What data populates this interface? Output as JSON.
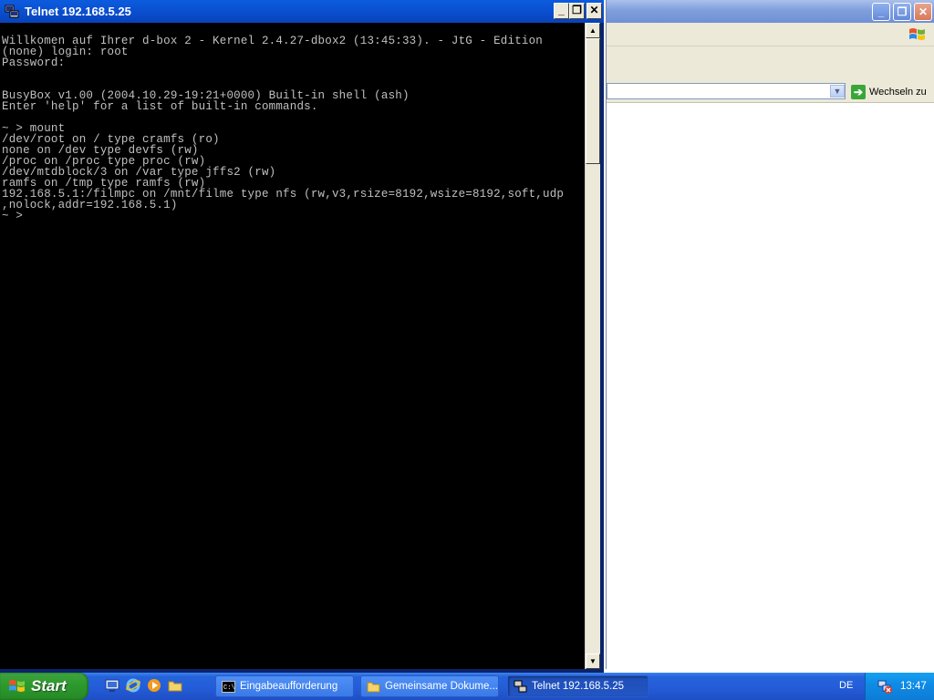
{
  "telnet_window": {
    "title": "Telnet 192.168.5.25",
    "console_lines": [
      "Willkomen auf Ihrer d-box 2 - Kernel 2.4.27-dbox2 (13:45:33). - JtG - Edition",
      "(none) login: root",
      "Password:",
      "",
      "",
      "BusyBox v1.00 (2004.10.29-19:21+0000) Built-in shell (ash)",
      "Enter 'help' for a list of built-in commands.",
      "",
      "~ > mount",
      "/dev/root on / type cramfs (ro)",
      "none on /dev type devfs (rw)",
      "/proc on /proc type proc (rw)",
      "/dev/mtdblock/3 on /var type jffs2 (rw)",
      "ramfs on /tmp type ramfs (rw)",
      "192.168.5.1:/filmpc on /mnt/filme type nfs (rw,v3,rsize=8192,wsize=8192,soft,udp",
      ",nolock,addr=192.168.5.1)",
      "~ > "
    ]
  },
  "background_window": {
    "go_button_label": "Wechseln zu"
  },
  "taskbar": {
    "start_label": "Start",
    "tasks": [
      {
        "label": "Eingabeaufforderung"
      },
      {
        "label": "Gemeinsame Dokume..."
      },
      {
        "label": "Telnet 192.168.5.25"
      }
    ],
    "language": "DE",
    "clock": "13:47"
  },
  "colors": {
    "console_bg": "#000000",
    "console_fg": "#c0c0c0",
    "titlebar_blue": "#0a4fd0",
    "taskbar_blue": "#245edb",
    "start_green": "#2e9b2e"
  }
}
